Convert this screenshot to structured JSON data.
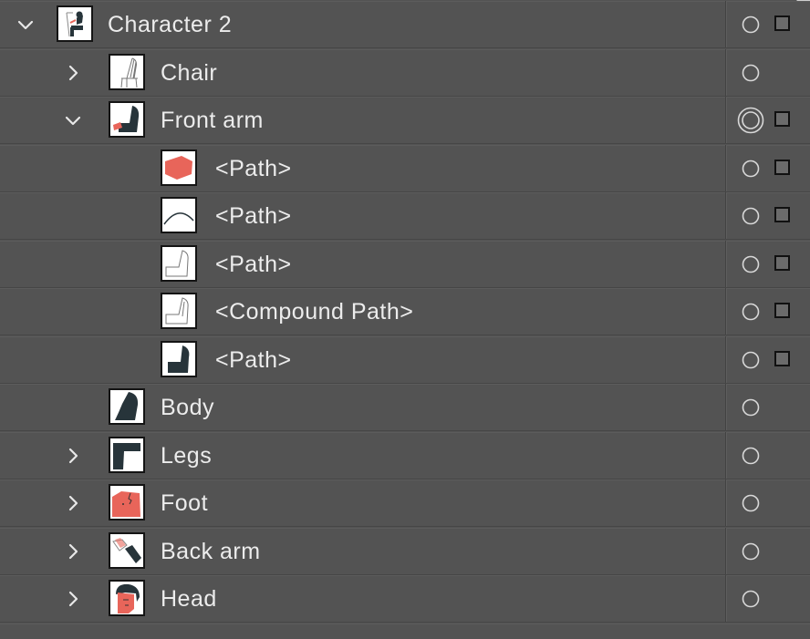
{
  "layers": [
    {
      "label": "Character 2",
      "indent": 0,
      "chevron": "down",
      "thumb": "character-thumb",
      "square": true,
      "selected_circle": false
    },
    {
      "label": "Chair",
      "indent": 1,
      "chevron": "right",
      "thumb": "chair-thumb",
      "square": false,
      "selected_circle": false
    },
    {
      "label": "Front arm",
      "indent": 1,
      "chevron": "down",
      "thumb": "front-arm-thumb",
      "square": true,
      "selected_circle": true
    },
    {
      "label": "<Path>",
      "indent": 2,
      "chevron": "none",
      "thumb": "hand-path-thumb",
      "square": true,
      "selected_circle": false
    },
    {
      "label": "<Path>",
      "indent": 2,
      "chevron": "none",
      "thumb": "arc-path-thumb",
      "square": true,
      "selected_circle": false
    },
    {
      "label": "<Path>",
      "indent": 2,
      "chevron": "none",
      "thumb": "sleeve-outline-thumb",
      "square": true,
      "selected_circle": false
    },
    {
      "label": "<Compound Path>",
      "indent": 2,
      "chevron": "none",
      "thumb": "compound-outline-thumb",
      "square": true,
      "selected_circle": false
    },
    {
      "label": "<Path>",
      "indent": 2,
      "chevron": "none",
      "thumb": "sleeve-fill-thumb",
      "square": true,
      "selected_circle": false
    },
    {
      "label": "Body",
      "indent": 1,
      "chevron": "none",
      "thumb": "body-thumb",
      "square": false,
      "selected_circle": false
    },
    {
      "label": "Legs",
      "indent": 1,
      "chevron": "right",
      "thumb": "legs-thumb",
      "square": false,
      "selected_circle": false
    },
    {
      "label": "Foot",
      "indent": 1,
      "chevron": "right",
      "thumb": "foot-thumb",
      "square": false,
      "selected_circle": false
    },
    {
      "label": "Back arm",
      "indent": 1,
      "chevron": "right",
      "thumb": "back-arm-thumb",
      "square": false,
      "selected_circle": false
    },
    {
      "label": "Head",
      "indent": 1,
      "chevron": "right",
      "thumb": "head-thumb",
      "square": false,
      "selected_circle": false
    }
  ],
  "colors": {
    "panel_bg": "#535353",
    "text": "#ececec",
    "dark_fill": "#27343a",
    "accent_red": "#e8655a"
  }
}
